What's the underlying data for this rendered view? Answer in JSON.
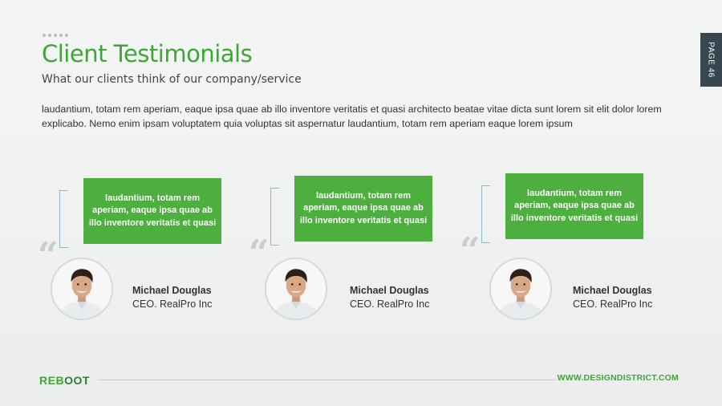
{
  "header": {
    "title": "Client Testimonials",
    "subtitle": "What our clients think of our company/service",
    "intro": "laudantium, totam rem aperiam, eaque ipsa quae ab illo inventore veritatis et quasi architecto beatae vitae dicta sunt lorem sit elit dolor lorem explicabo. Nemo enim ipsam voluptatem quia voluptas sit aspernatur laudantium, totam rem aperiam eaque lorem ipsum"
  },
  "page_tab": {
    "label": "PAGE 46"
  },
  "testimonials": [
    {
      "quote": "laudantium, totam rem aperiam, eaque ipsa quae ab illo inventore veritatis et quasi",
      "name": "Michael Douglas",
      "role": "CEO. RealPro Inc",
      "quote_mark": "“"
    },
    {
      "quote": "laudantium, totam rem aperiam, eaque ipsa quae ab illo inventore veritatis et quasi",
      "name": "Michael Douglas",
      "role": "CEO. RealPro Inc",
      "quote_mark": "“"
    },
    {
      "quote": "laudantium, totam rem aperiam, eaque ipsa quae ab illo inventore veritatis et quasi",
      "name": "Michael Douglas",
      "role": "CEO. RealPro Inc",
      "quote_mark": "“"
    }
  ],
  "footer": {
    "logo_part1": "REB",
    "logo_part2": "OOT",
    "url": "WWW.DESIGNDISTRICT.COM"
  },
  "colors": {
    "accent": "#3fa535",
    "bubble": "#4caf3e",
    "page_tab": "#37474f"
  }
}
